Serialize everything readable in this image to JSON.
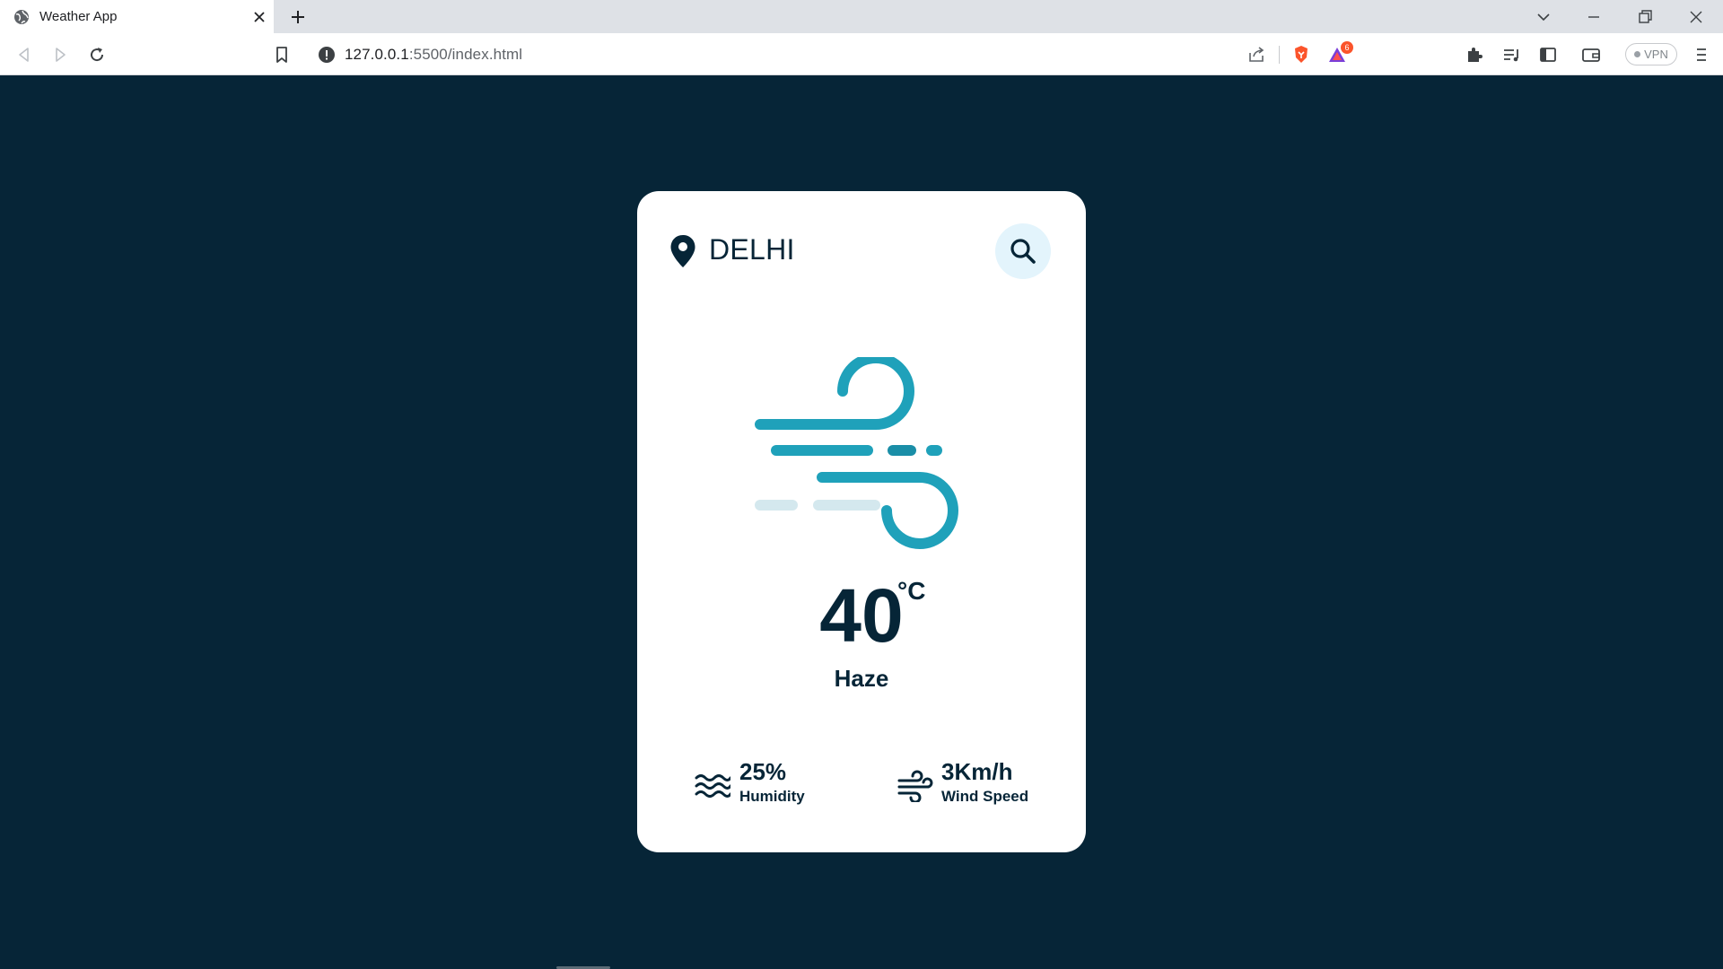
{
  "browser": {
    "tab_title": "Weather App",
    "url_host": "127.0.0.1",
    "url_path": ":5500/index.html",
    "vpn_label": "VPN",
    "notification_count": "6"
  },
  "weather": {
    "city": "DELHI",
    "temperature": "40",
    "unit": "°C",
    "condition": "Haze",
    "humidity_value": "25%",
    "humidity_label": "Humidity",
    "wind_value": "3Km/h",
    "wind_label": "Wind Speed",
    "icon": "wind-icon"
  },
  "colors": {
    "page_background": "#062537",
    "card_background": "#ffffff",
    "text_primary": "#062537",
    "search_button": "#e3f4fc",
    "wind_primary": "#1fa1ba",
    "wind_light": "#d4e8ee"
  }
}
